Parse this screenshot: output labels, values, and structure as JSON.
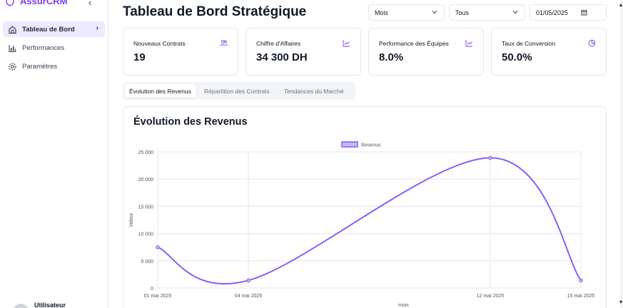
{
  "sidebar": {
    "brand": "AssurCRM",
    "items": [
      {
        "label": "Tableau de Bord",
        "icon": "home-icon",
        "active": true
      },
      {
        "label": "Performances",
        "icon": "bar-chart-icon",
        "active": false
      },
      {
        "label": "Paramètres",
        "icon": "gear-icon",
        "active": false
      }
    ],
    "user": "Utilisateur"
  },
  "header": {
    "title": "Tableau de Bord Stratégique",
    "period_select": "Mois",
    "team_select": "Tous",
    "date": "01/05/2025"
  },
  "kpis": [
    {
      "label": "Nouveaux Contrats",
      "value": "19",
      "icon": "users-icon"
    },
    {
      "label": "Chiffre d'Affaires",
      "value": "34 300 DH",
      "icon": "line-chart-icon"
    },
    {
      "label": "Performance des Équipes",
      "value": "8.0%",
      "icon": "line-chart-icon"
    },
    {
      "label": "Taux de Conversion",
      "value": "50.0%",
      "icon": "pie-chart-icon"
    }
  ],
  "tabs": [
    {
      "label": "Évolution des Revenus",
      "active": true
    },
    {
      "label": "Répartition des Contrats",
      "active": false
    },
    {
      "label": "Tendances du Marché",
      "active": false
    }
  ],
  "colors": {
    "accent": "#7c3aed",
    "line": "#8b5cf6"
  },
  "chart_data": {
    "type": "line",
    "title": "Évolution des Revenus",
    "xlabel": "mois",
    "ylabel": "Valeur",
    "x": [
      "01 mai 2025",
      "04 mai 2025",
      "12 mai 2025",
      "15 mai 2025"
    ],
    "x_days": [
      1,
      4,
      12,
      15
    ],
    "series": [
      {
        "name": "Revenus",
        "values": [
          7500,
          1400,
          23900,
          1400
        ]
      }
    ],
    "ylim": [
      0,
      25000
    ],
    "yticks": [
      0,
      5000,
      10000,
      15000,
      20000,
      25000
    ],
    "ytick_labels": [
      "0",
      "5 000",
      "10 000",
      "15 000",
      "20 000",
      "25 000"
    ],
    "grid": true,
    "legend": "top"
  }
}
